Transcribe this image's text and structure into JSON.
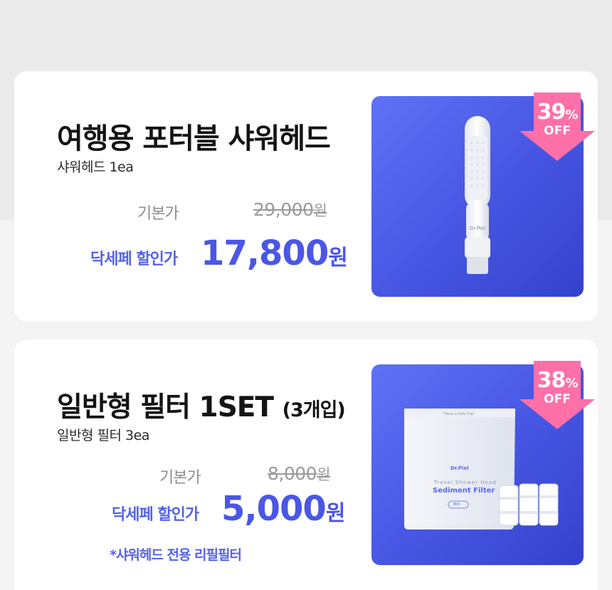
{
  "products": [
    {
      "title": "여행용 포터블 샤워헤드",
      "title_suffix": "",
      "subtitle": "샤워헤드 1ea",
      "base_label": "기본가",
      "original_price": "29,000",
      "original_unit": "원",
      "sale_label": "닥세페 할인가",
      "sale_price": "17,800",
      "sale_unit": "원",
      "badge_percent": "39",
      "badge_percent_sign": "%",
      "badge_off": "OFF",
      "image_brand": "Dr.Piel",
      "note": ""
    },
    {
      "title": "일반형 필터 1SET ",
      "title_suffix": "(3개입)",
      "subtitle": "일반형 필터 3ea",
      "base_label": "기본가",
      "original_price": "8,000",
      "original_unit": "원",
      "sale_label": "닥세페 할인가",
      "sale_price": "5,000",
      "sale_unit": "원",
      "badge_percent": "38",
      "badge_percent_sign": "%",
      "badge_off": "OFF",
      "image_brand": "Dr.Piel",
      "image_tagline": "\"Have a Safe Trip\"",
      "image_line1": "Travel Shower Head",
      "image_line2": "Sediment Filter",
      "image_count": "3EA",
      "note": "*샤워헤드 전용 리필필터"
    }
  ],
  "colors": {
    "accent": "#4a57e6",
    "badge": "#ff6fa8",
    "image_bg_start": "#5f72f5",
    "image_bg_end": "#3441cc"
  }
}
